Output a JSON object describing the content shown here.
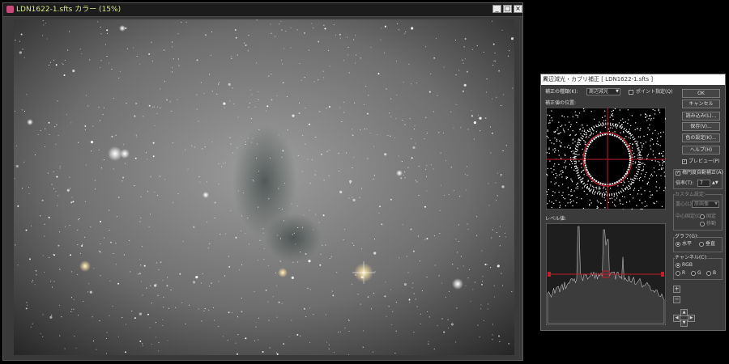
{
  "image_window": {
    "title": "LDN1622-1.sfts カラー (15%)",
    "colors": {
      "title_text": "#d9e889",
      "frame": "#3a3a3a"
    }
  },
  "dialog": {
    "title": "周辺減光・カブリ補正 [ LDN1622-1.sfts ]",
    "correction_type_label": "補正の種類(K):",
    "correction_type_value": "周辺減光",
    "point_spec_label": "ポイント指定(Q)",
    "correction_position_label": "補正値の位置:",
    "level_label": "レベル値:",
    "buttons": {
      "ok": "OK",
      "cancel": "キャンセル",
      "load": "読み込み(L)...",
      "save": "保存(V)...",
      "color_settings": "色の設定(K)...",
      "help": "ヘルプ(H)"
    },
    "preview_label": "プレビュー(P)",
    "ellipse_fit_label": "楕円度自動補正(A)",
    "magnification_label": "倍率(T):",
    "magnification_value": "7",
    "custom_settings_label": "カスタム設定:",
    "balance_label": "重心(L):",
    "balance_value": "原画像",
    "center_label": "中心固定(C):",
    "center_option_fixed": "固定",
    "center_option_move": "移動",
    "graph_label": "グラフ(G):",
    "graph_horizontal": "水平",
    "graph_vertical": "垂直",
    "channel_label": "チャンネル(C):",
    "channel_rgb": "RGB",
    "channel_r": "R",
    "channel_g": "G",
    "channel_b": "B",
    "zoom_plus": "+",
    "zoom_minus": "−"
  }
}
